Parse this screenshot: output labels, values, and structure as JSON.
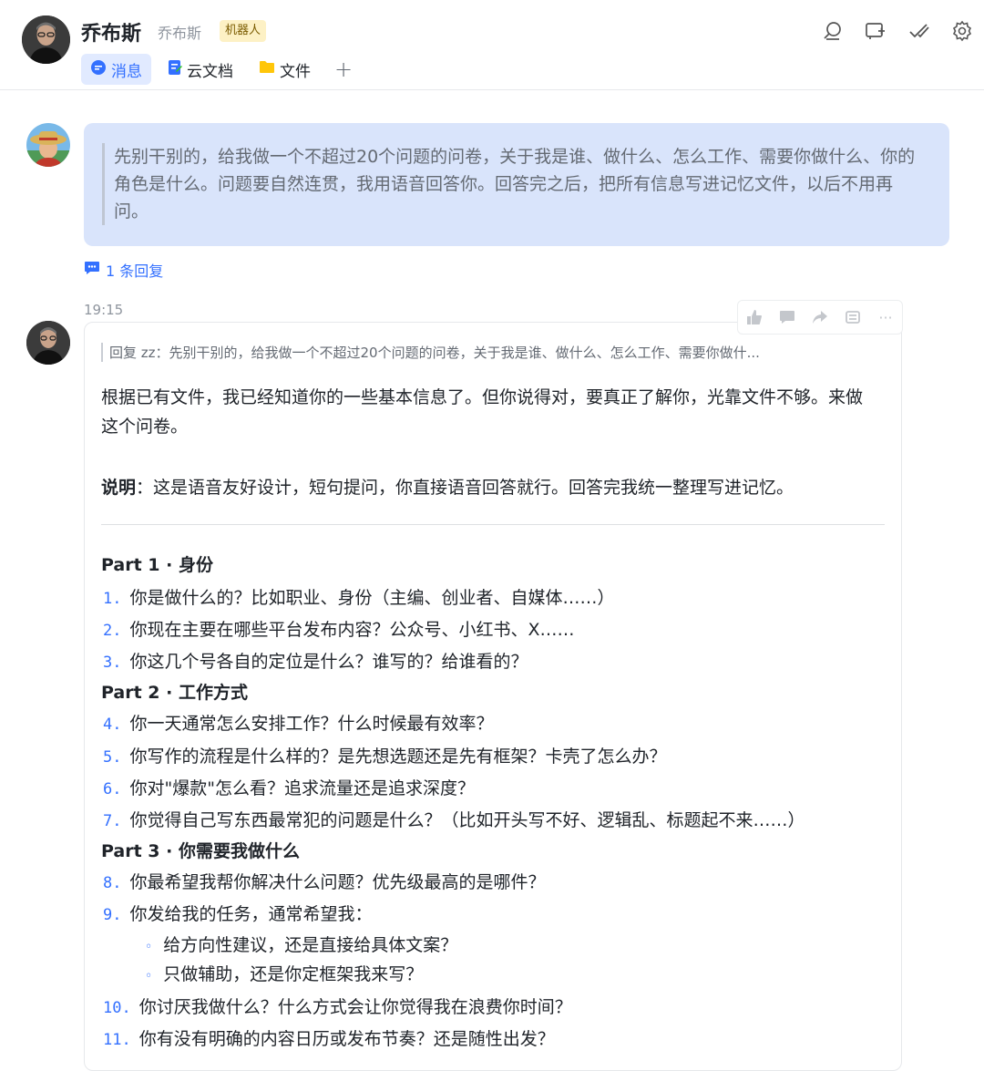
{
  "header": {
    "name": "乔布斯",
    "alias": "乔布斯",
    "badge": "机器人",
    "tabs": [
      {
        "label": "消息",
        "icon": "chat-bubble-icon",
        "active": true
      },
      {
        "label": "云文档",
        "icon": "doc-icon",
        "active": false
      },
      {
        "label": "文件",
        "icon": "folder-icon",
        "active": false
      }
    ],
    "add_tab": "+",
    "icons": [
      "search-icon",
      "add-chat-icon",
      "checkmark-icon",
      "settings-icon"
    ]
  },
  "user_message": {
    "quote": "先别干别的，给我做一个不超过20个问题的问卷，关于我是谁、做什么、怎么工作、需要你做什么、你的角色是什么。问题要自然连贯，我用语音回答你。回答完之后，把所有信息写进记忆文件，以后不用再问。",
    "reply_count": "1 条回复"
  },
  "bot_message": {
    "time": "19:15",
    "reply_quote": "回复 zz：先别干别的，给我做一个不超过20个问题的问卷，关于我是谁、做什么、怎么工作、需要你做什...",
    "intro": "根据已有文件，我已经知道你的一些基本信息了。但你说得对，要真正了解你，光靠文件不够。来做这个问卷。",
    "note_label": "说明",
    "note_text": "：这是语音友好设计，短句提问，你直接语音回答就行。回答完我统一整理写进记忆。",
    "parts": [
      "Part 1 · 身份",
      "Part 2 · 工作方式",
      "Part 3 · 你需要我做什么"
    ],
    "questions": [
      {
        "n": "1.",
        "text": "你是做什么的？比如职业、身份（主编、创业者、自媒体……）"
      },
      {
        "n": "2.",
        "text": "你现在主要在哪些平台发布内容？公众号、小红书、X……"
      },
      {
        "n": "3.",
        "text": "你这几个号各自的定位是什么？谁写的？给谁看的？"
      },
      {
        "n": "4.",
        "text": "你一天通常怎么安排工作？什么时候最有效率？"
      },
      {
        "n": "5.",
        "text": "你写作的流程是什么样的？是先想选题还是先有框架？卡壳了怎么办？"
      },
      {
        "n": "6.",
        "text": "你对\"爆款\"怎么看？追求流量还是追求深度？"
      },
      {
        "n": "7.",
        "text": "你觉得自己写东西最常犯的问题是什么？（比如开头写不好、逻辑乱、标题起不来……）"
      },
      {
        "n": "8.",
        "text": "你最希望我帮你解决什么问题？优先级最高的是哪件？"
      },
      {
        "n": "9.",
        "text": "你发给我的任务，通常希望我："
      },
      {
        "n": "10.",
        "text": "你讨厌我做什么？什么方式会让你觉得我在浪费你时间？"
      },
      {
        "n": "11.",
        "text": "你有没有明确的内容日历或发布节奏？还是随性出发？"
      }
    ],
    "sub_items": [
      "给方向性建议，还是直接给具体文案？",
      "只做辅助，还是你定框架我来写？"
    ],
    "bullet": "◦",
    "toolbar_icons": [
      "thumbs-up-icon",
      "comment-icon",
      "forward-icon",
      "pin-icon",
      "more-icon"
    ],
    "more_label": "···"
  },
  "colors": {
    "accent": "#3370ff",
    "quote_bg": "#d9e4fb",
    "tab_active_bg": "#e1eaff",
    "badge_bg": "#fdf1c5"
  }
}
